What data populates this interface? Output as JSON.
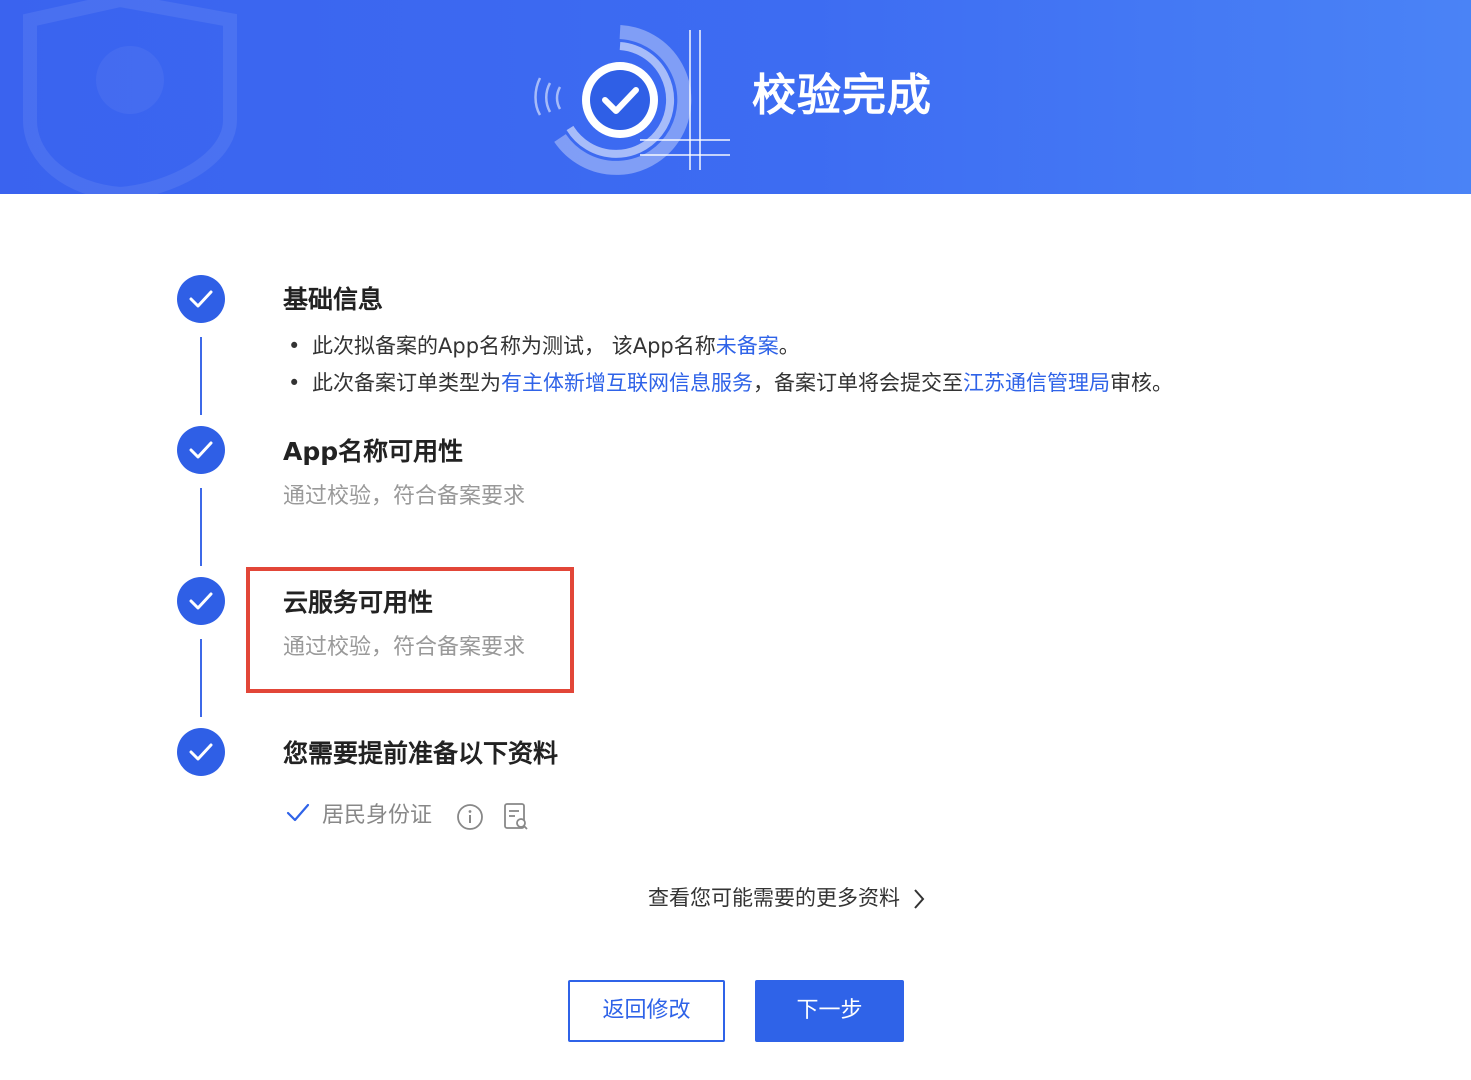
{
  "banner": {
    "title": "校验完成"
  },
  "steps": [
    {
      "title": "基础信息",
      "bullets": [
        {
          "t1": "此次拟备案的App名称为测试，  该App名称",
          "link1": "未备案",
          "t2": "。"
        },
        {
          "t1": "此次备案订单类型为",
          "link1": "有主体新增互联网信息服务",
          "t2": "，备案订单将会提交至",
          "link2": "江苏通信管理局",
          "t3": "审核。"
        }
      ]
    },
    {
      "title": "App名称可用性",
      "subtitle": "通过校验，符合备案要求"
    },
    {
      "title": "云服务可用性",
      "subtitle": "通过校验，符合备案要求"
    },
    {
      "title": "您需要提前准备以下资料"
    }
  ],
  "documents": [
    {
      "label": "居民身份证",
      "icons": [
        "info-icon",
        "document-preview-icon"
      ]
    }
  ],
  "more_link": "查看您可能需要的更多资料",
  "buttons": {
    "back": "返回修改",
    "next": "下一步"
  },
  "colors": {
    "primary": "#2f63e8",
    "highlight": "#e24638",
    "banner": "#3a63ef"
  }
}
